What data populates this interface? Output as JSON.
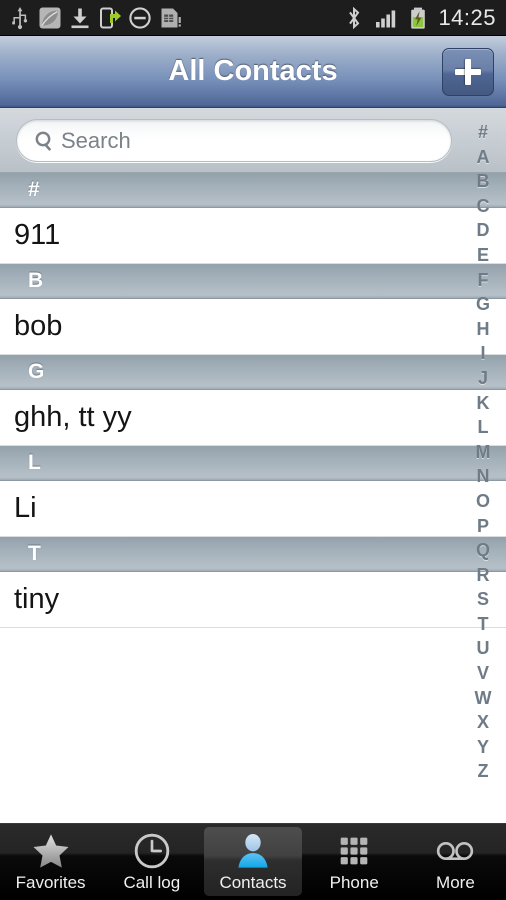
{
  "statusbar": {
    "icons_left": [
      "usb-icon",
      "leaf-icon",
      "download-icon",
      "phone-transfer-icon",
      "do-not-disturb-icon",
      "sim-card-icon"
    ],
    "icons_right": [
      "bluetooth-icon",
      "signal-bars-icon",
      "battery-charging-icon"
    ],
    "clock": "14:25",
    "background": "#1d1d1d",
    "battery_color": "#8cc63f"
  },
  "titlebar": {
    "title": "All Contacts",
    "add_button_icon": "plus-icon",
    "gradient_top": "#c3cddd",
    "gradient_bottom": "#3d5580"
  },
  "search": {
    "icon": "search-icon",
    "placeholder": "Search",
    "value": ""
  },
  "list": {
    "sections": [
      {
        "header": "#",
        "contacts": [
          "911"
        ]
      },
      {
        "header": "B",
        "contacts": [
          "bob"
        ]
      },
      {
        "header": "G",
        "contacts": [
          "ghh, tt yy"
        ]
      },
      {
        "header": "L",
        "contacts": [
          "Li"
        ]
      },
      {
        "header": "T",
        "contacts": [
          "tiny"
        ]
      }
    ]
  },
  "az_index": {
    "letters": [
      "#",
      "A",
      "B",
      "C",
      "D",
      "E",
      "F",
      "G",
      "H",
      "I",
      "J",
      "K",
      "L",
      "M",
      "N",
      "O",
      "P",
      "Q",
      "R",
      "S",
      "T",
      "U",
      "V",
      "W",
      "X",
      "Y",
      "Z"
    ],
    "color": "#6f7b86"
  },
  "tabbar": {
    "active_index": 2,
    "active_color": "#37b6ef",
    "tabs": [
      {
        "label": "Favorites",
        "icon": "star-icon"
      },
      {
        "label": "Call log",
        "icon": "clock-icon"
      },
      {
        "label": "Contacts",
        "icon": "person-icon"
      },
      {
        "label": "Phone",
        "icon": "keypad-icon"
      },
      {
        "label": "More",
        "icon": "voicemail-icon"
      }
    ]
  }
}
